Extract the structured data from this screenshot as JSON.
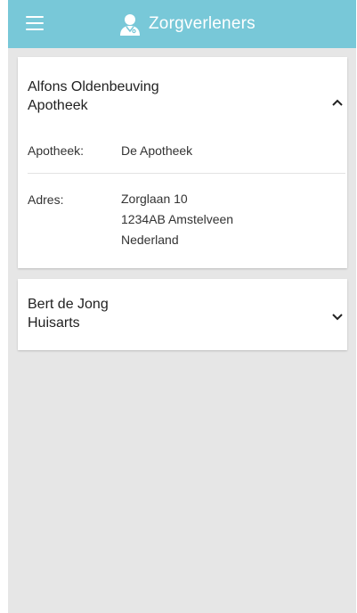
{
  "header": {
    "title": "Zorgverleners",
    "menu_icon": "hamburger-menu-icon",
    "title_icon": "doctor-icon",
    "background_color": "#78c8d8"
  },
  "providers": [
    {
      "name": "Alfons Oldenbeuving",
      "role": "Apotheek",
      "expanded": true,
      "chevron_icon": "chevron-up-icon",
      "details": {
        "apotheek_label": "Apotheek:",
        "apotheek_value": "De Apotheek",
        "adres_label": "Adres:",
        "address_line1": "Zorglaan 10",
        "address_line2": "1234AB Amstelveen",
        "address_line3": "Nederland"
      }
    },
    {
      "name": "Bert de Jong",
      "role": "Huisarts",
      "expanded": false,
      "chevron_icon": "chevron-down-icon"
    }
  ]
}
